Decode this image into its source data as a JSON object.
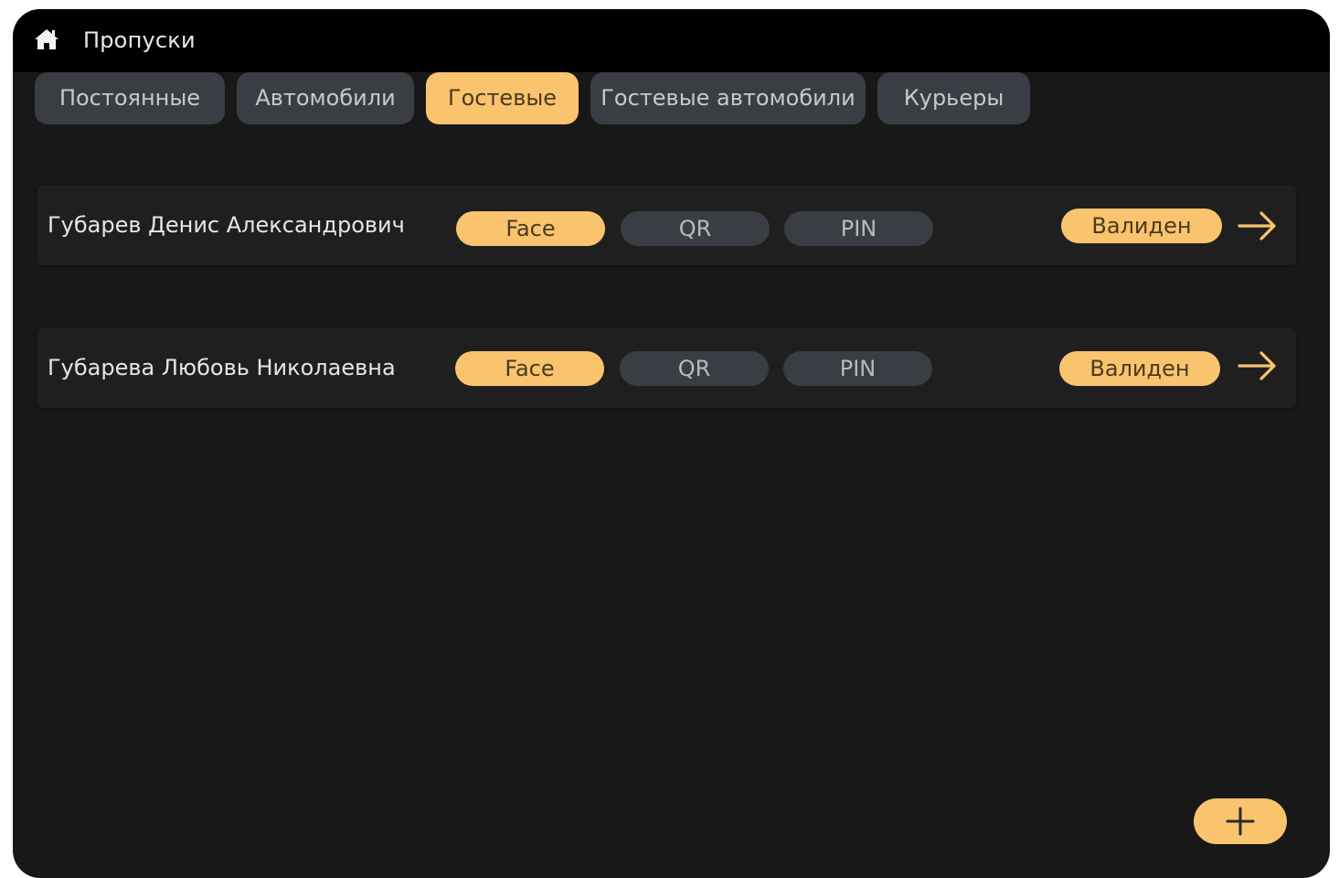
{
  "header": {
    "title": "Пропуски",
    "home_icon": "home-icon"
  },
  "tabs": [
    {
      "label": "Постоянные",
      "active": false
    },
    {
      "label": "Автомобили",
      "active": false
    },
    {
      "label": "Гостевые",
      "active": true
    },
    {
      "label": "Гостевые автомобили",
      "active": false
    },
    {
      "label": "Курьеры",
      "active": false
    }
  ],
  "passes": [
    {
      "name": "Губарев Денис Александрович",
      "methods": [
        {
          "label": "Face",
          "enabled": true
        },
        {
          "label": "QR",
          "enabled": false
        },
        {
          "label": "PIN",
          "enabled": false
        }
      ],
      "status": "Валиден"
    },
    {
      "name": "Губарева Любовь Николаевна",
      "methods": [
        {
          "label": "Face",
          "enabled": true
        },
        {
          "label": "QR",
          "enabled": false
        },
        {
          "label": "PIN",
          "enabled": false
        }
      ],
      "status": "Валиден"
    }
  ],
  "add_button": {
    "icon": "plus-icon"
  },
  "colors": {
    "accent": "#f9c46d",
    "background": "#181818",
    "topbar": "#000000",
    "chip_inactive": "#3a3d43",
    "row_background": "#1f1f1f"
  }
}
